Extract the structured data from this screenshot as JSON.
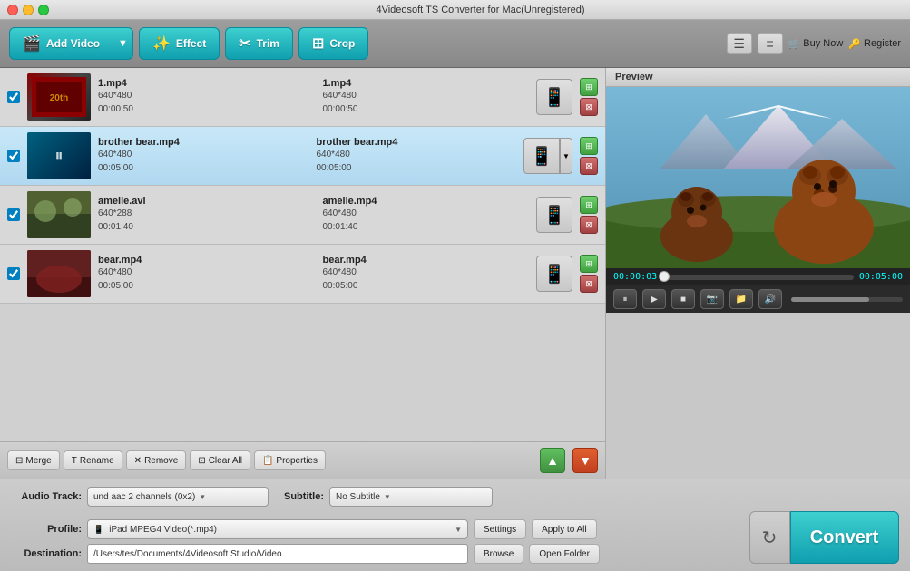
{
  "window": {
    "title": "4Videosoft TS Converter for Mac(Unregistered)"
  },
  "toolbar": {
    "add_video_label": "Add Video",
    "effect_label": "Effect",
    "trim_label": "Trim",
    "crop_label": "Crop",
    "buy_now_label": "Buy Now",
    "register_label": "Register"
  },
  "files": [
    {
      "name": "1.mp4",
      "src_resolution": "640*480",
      "src_duration": "00:00:50",
      "out_name": "1.mp4",
      "out_resolution": "640*480",
      "out_duration": "00:00:50",
      "checked": true,
      "playing": false,
      "thumb_class": "thumb-1"
    },
    {
      "name": "brother bear.mp4",
      "src_resolution": "640*480",
      "src_duration": "00:05:00",
      "out_name": "brother bear.mp4",
      "out_resolution": "640*480",
      "out_duration": "00:05:00",
      "checked": true,
      "playing": true,
      "thumb_class": "thumb-2"
    },
    {
      "name": "amelie.avi",
      "src_resolution": "640*288",
      "src_duration": "00:01:40",
      "out_name": "amelie.mp4",
      "out_resolution": "640*480",
      "out_duration": "00:01:40",
      "checked": true,
      "playing": false,
      "thumb_class": "thumb-3"
    },
    {
      "name": "bear.mp4",
      "src_resolution": "640*480",
      "src_duration": "00:05:00",
      "out_name": "bear.mp4",
      "out_resolution": "640*480",
      "out_duration": "00:05:00",
      "checked": true,
      "playing": false,
      "thumb_class": "thumb-4"
    }
  ],
  "action_bar": {
    "merge_label": "Merge",
    "rename_label": "Rename",
    "remove_label": "Remove",
    "clear_all_label": "Clear All",
    "properties_label": "Properties"
  },
  "preview": {
    "header": "Preview",
    "current_time": "00:00:03",
    "total_time": "00:05:00",
    "progress_pct": 1
  },
  "playback_controls": {
    "pause_icon": "⏸",
    "play_icon": "▶",
    "stop_icon": "■",
    "snapshot_icon": "📷",
    "folder_icon": "📁",
    "volume_icon": "🔊"
  },
  "settings": {
    "audio_track_label": "Audio Track:",
    "audio_track_value": "und aac 2 channels (0x2)",
    "subtitle_label": "Subtitle:",
    "subtitle_value": "No Subtitle",
    "profile_label": "Profile:",
    "profile_value": "iPad MPEG4 Video(*.mp4)",
    "settings_btn": "Settings",
    "apply_to_all_btn": "Apply to All",
    "destination_label": "Destination:",
    "destination_value": "/Users/tes/Documents/4Videosoft Studio/Video",
    "browse_btn": "Browse",
    "open_folder_btn": "Open Folder",
    "convert_btn": "Convert"
  }
}
